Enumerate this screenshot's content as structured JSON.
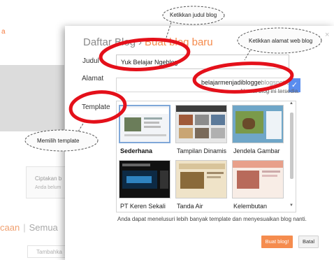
{
  "background": {
    "label_top": "a",
    "card_title": "Ciptakan b",
    "card_sub": "Anda belum",
    "tab_a": "caan",
    "tab_sep": "|",
    "tab_b": "Semua",
    "button": "Tambahka"
  },
  "dialog": {
    "breadcrumb_parent": "Daftar Blog",
    "breadcrumb_sep": "›",
    "breadcrumb_current": "Buat blog baru",
    "close": "×",
    "title_label": "Judul",
    "title_value": "Yuk Belajar Ngeblog",
    "address_label": "Alamat",
    "address_value": "belajarmenjadiblogger",
    "address_suffix": ".blogspot.co",
    "address_ok": "✓",
    "address_hint": "Alamat blog ini tersedia.",
    "template_label": "Template",
    "templates": [
      {
        "name": "Sederhana",
        "selected": true
      },
      {
        "name": "Tampilan Dinamis",
        "selected": false
      },
      {
        "name": "Jendela Gambar",
        "selected": false
      },
      {
        "name": "PT Keren Sekali",
        "selected": false
      },
      {
        "name": "Tanda Air",
        "selected": false
      },
      {
        "name": "Kelembutan",
        "selected": false
      }
    ],
    "footer_note": "Anda dapat menelusuri lebih banyak template dan menyesuaikan blog nanti.",
    "create_button": "Buat blog!",
    "cancel_button": "Batal"
  },
  "annotations": {
    "title_callout": "Ketikkan judul blog",
    "address_callout": "Ketikkan alamat web blog",
    "template_callout": "Memilih template",
    "ring_color": "#e4101a"
  }
}
